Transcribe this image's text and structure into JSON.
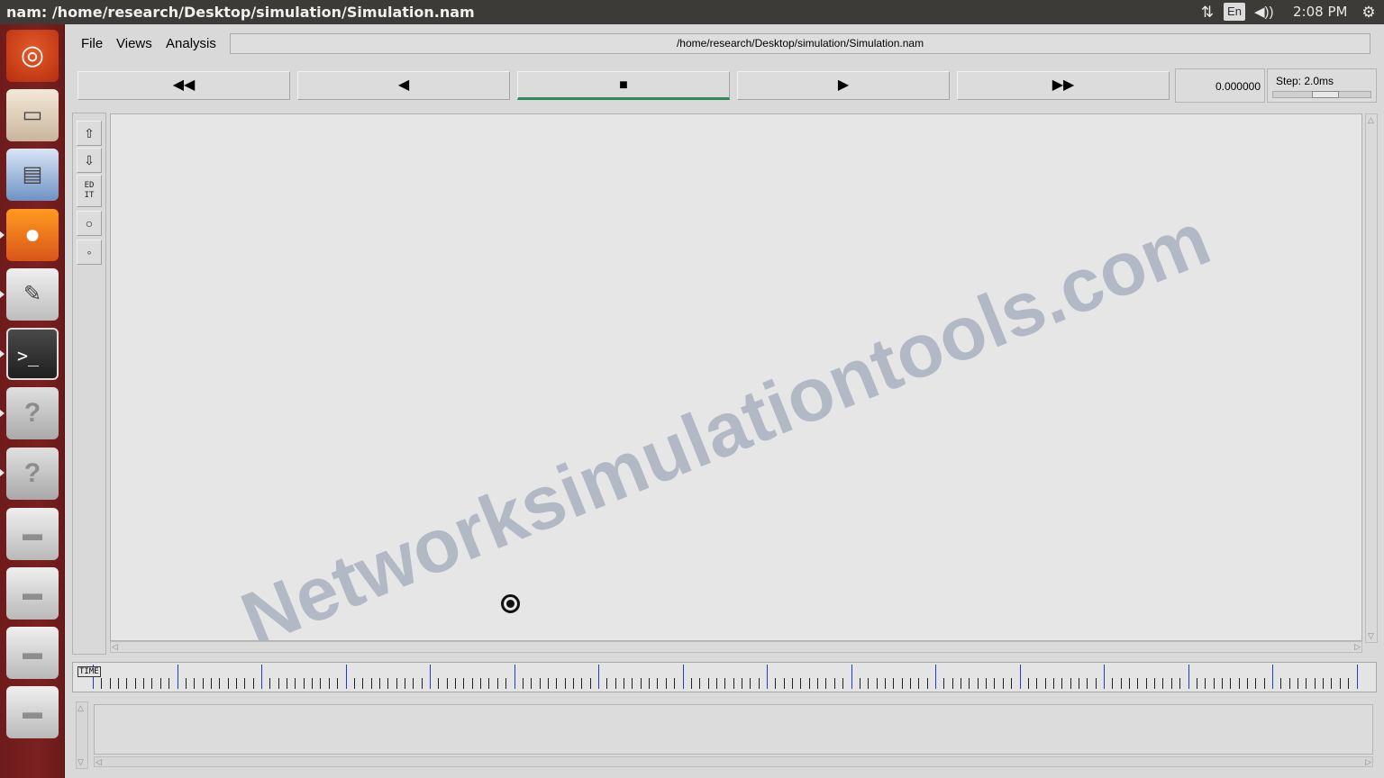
{
  "topbar": {
    "title": "nam: /home/research/Desktop/simulation/Simulation.nam",
    "keyboard": "En",
    "clock": "2:08 PM",
    "icons": [
      "network-icon",
      "keyboard-layout-icon",
      "volume-icon",
      "settings-gear-icon"
    ]
  },
  "launcher": {
    "items": [
      {
        "name": "ubuntu-dash",
        "glyph": "◎"
      },
      {
        "name": "files",
        "glyph": "▭"
      },
      {
        "name": "libreoffice-writer",
        "glyph": "▤"
      },
      {
        "name": "firefox",
        "glyph": "●"
      },
      {
        "name": "text-editor",
        "glyph": "✎"
      },
      {
        "name": "terminal",
        "glyph": ">_"
      },
      {
        "name": "unknown-app-1",
        "glyph": "?"
      },
      {
        "name": "unknown-app-2",
        "glyph": "?"
      },
      {
        "name": "drive-1",
        "glyph": "▬"
      },
      {
        "name": "drive-2",
        "glyph": "▬"
      },
      {
        "name": "drive-3",
        "glyph": "▬"
      },
      {
        "name": "drive-4",
        "glyph": "▬"
      }
    ]
  },
  "menu": {
    "file": "File",
    "views": "Views",
    "analysis": "Analysis"
  },
  "path": "/home/research/Desktop/simulation/Simulation.nam",
  "controls": {
    "rewind": "◀◀",
    "back": "◀",
    "stop": "■",
    "play": "▶",
    "fast_forward": "▶▶",
    "active": "stop"
  },
  "time_display": "0.000000",
  "step": {
    "label": "Step: 2.0ms",
    "slider_position": 0.55
  },
  "tools": {
    "zoom_in": "⇧",
    "zoom_out": "⇩",
    "edit": "ED IT",
    "circle_large": "○",
    "circle_small": "◦"
  },
  "canvas": {
    "watermark": "Networksimulationtools.com"
  },
  "timeline": {
    "label": "TIME"
  },
  "colors": {
    "topbar": "#3c3b37",
    "launcher": "#7c2020",
    "active_button_indicator": "#2e8b57",
    "major_tick": "#1a3fd6",
    "watermark": "#a9b2bf"
  }
}
